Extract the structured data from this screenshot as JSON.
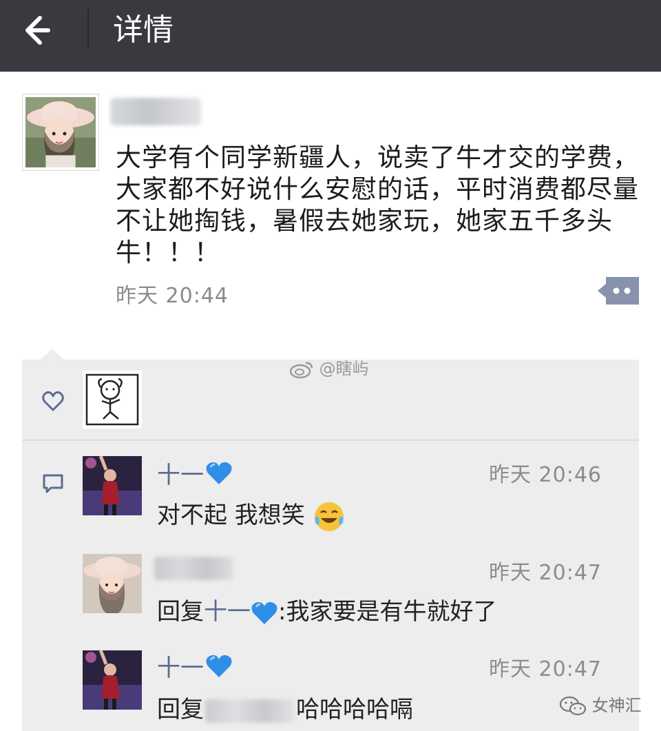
{
  "header": {
    "title": "详情",
    "back_icon": "arrow-left-icon"
  },
  "post": {
    "text": "大学有个同学新疆人，说卖了牛才交的学费，大家都不好说什么安慰的话，平时消费都尽量不让她掏钱，暑假去她家玩，她家五千多头牛！！！",
    "time": "昨天 20:44",
    "more_icon": "more-dots-icon"
  },
  "likes": {
    "icon": "heart-outline-icon"
  },
  "comments": {
    "icon": "comment-bubble-icon",
    "items": [
      {
        "name": "十一",
        "time": "昨天 20:46",
        "text": "对不起  我想笑"
      },
      {
        "time": "昨天 20:47",
        "reply_prefix": "回复",
        "reply_to": "十一",
        "text": ":我家要是有牛就好了"
      },
      {
        "name": "十一",
        "time": "昨天 20:47",
        "reply_prefix": "回复",
        "text": "哈哈哈哈嗝"
      }
    ]
  },
  "watermarks": {
    "weibo": "@瞎屿",
    "wechat": "女神汇"
  },
  "colors": {
    "topbar": "#393a3f",
    "link": "#5b6b92",
    "panel": "#ededed"
  }
}
